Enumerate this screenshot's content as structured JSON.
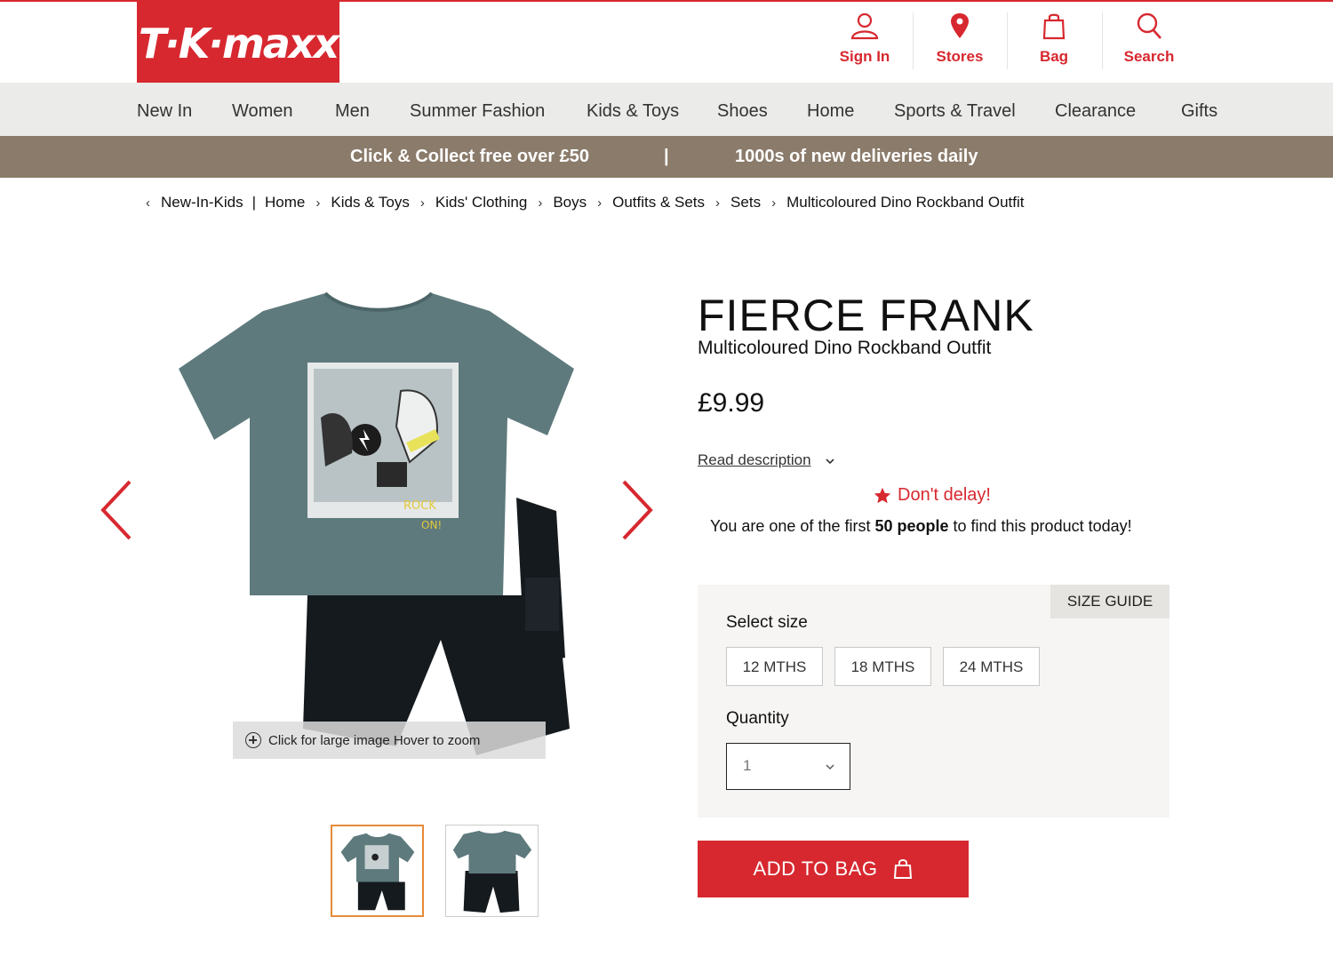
{
  "header": {
    "logo_text": "T·K·maxx",
    "brand_color": "#d7282f",
    "utility": [
      {
        "label": "Sign In",
        "icon": "user-icon"
      },
      {
        "label": "Stores",
        "icon": "location-pin-icon"
      },
      {
        "label": "Bag",
        "icon": "bag-icon"
      },
      {
        "label": "Search",
        "icon": "search-icon"
      }
    ]
  },
  "nav": {
    "items": [
      "New In",
      "Women",
      "Men",
      "Summer Fashion",
      "Kids & Toys",
      "Shoes",
      "Home",
      "Sports & Travel",
      "Clearance",
      "Gifts"
    ]
  },
  "promo": {
    "left": "Click & Collect free over £50",
    "divider": "|",
    "right": "1000s of new deliveries daily",
    "background": "#8b7b6a"
  },
  "breadcrumb": {
    "back": "New-In-Kids",
    "divider": "|",
    "items": [
      "Home",
      "Kids & Toys",
      "Kids' Clothing",
      "Boys",
      "Outfits & Sets",
      "Sets",
      "Multicoloured Dino Rockband Outfit"
    ]
  },
  "gallery": {
    "zoom_hint": "Click for large image Hover to zoom",
    "thumbnail_count": 2,
    "active_thumbnail": 1
  },
  "product": {
    "brand": "FIERCE FRANK",
    "name": "Multicoloured Dino Rockband Outfit",
    "price": "£9.99",
    "read_description": "Read description",
    "urgency_title": "Don't delay!",
    "urgency_pre": "You are one of the first ",
    "urgency_count": "50 people",
    "urgency_post": " to find this product today!"
  },
  "options": {
    "size_guide": "SIZE GUIDE",
    "select_size_label": "Select size",
    "sizes": [
      "12 MTHS",
      "18 MTHS",
      "24 MTHS"
    ],
    "quantity_label": "Quantity",
    "quantity_value": "1"
  },
  "cta": {
    "add_to_bag": "ADD TO BAG"
  }
}
